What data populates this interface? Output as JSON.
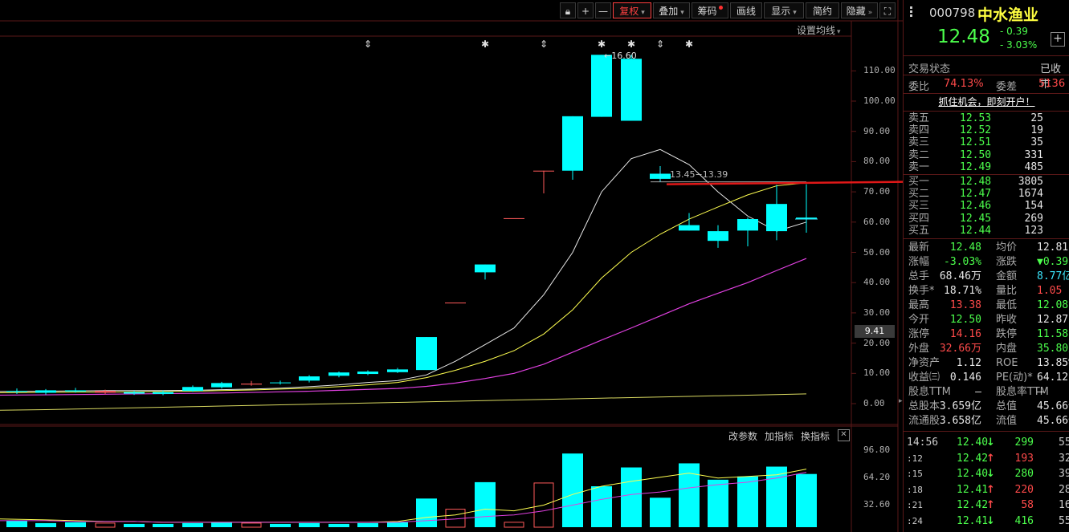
{
  "toolbar": {
    "items": [
      "复权",
      "叠加",
      "筹码",
      "画线",
      "显示",
      "简约",
      "隐藏"
    ],
    "plus": "+",
    "minus": "—",
    "setting_ma": "设置均线"
  },
  "chart": {
    "high_label": "16.60",
    "range_label": "13.45−13.39",
    "price_axis": [
      "110.00",
      "100.00",
      "90.00",
      "80.00",
      "70.00",
      "60.00",
      "50.00",
      "40.00",
      "30.00",
      "20.00",
      "10.00",
      "0.00"
    ],
    "current_marker": "9.41",
    "vol_axis": [
      "96.80",
      "64.20",
      "32.60"
    ],
    "vol_buttons": [
      "改参数",
      "加指标",
      "换指标"
    ]
  },
  "header": {
    "code": "000798",
    "name": "中水渔业",
    "price": "12.48",
    "change": "- 0.39",
    "change_pct": "- 3.03%",
    "plus": "+"
  },
  "status": {
    "label": "交易状态",
    "value": "已收市",
    "weibi_label": "委比",
    "weibi_value": "74.13%",
    "weicha_label": "委差",
    "weicha_value": "5136",
    "banner": "抓住机会，即刻开户！"
  },
  "sell": [
    {
      "label": "卖五",
      "price": "12.53",
      "vol": "25"
    },
    {
      "label": "卖四",
      "price": "12.52",
      "vol": "19"
    },
    {
      "label": "卖三",
      "price": "12.51",
      "vol": "35"
    },
    {
      "label": "卖二",
      "price": "12.50",
      "vol": "331"
    },
    {
      "label": "卖一",
      "price": "12.49",
      "vol": "485"
    }
  ],
  "buy": [
    {
      "label": "买一",
      "price": "12.48",
      "vol": "3805"
    },
    {
      "label": "买二",
      "price": "12.47",
      "vol": "1674"
    },
    {
      "label": "买三",
      "price": "12.46",
      "vol": "154"
    },
    {
      "label": "买四",
      "price": "12.45",
      "vol": "269"
    },
    {
      "label": "买五",
      "price": "12.44",
      "vol": "123"
    }
  ],
  "stats": [
    {
      "l1": "最新",
      "v1": "12.48",
      "c1": "green",
      "l2": "均价",
      "v2": "12.81",
      "c2": "white"
    },
    {
      "l1": "涨幅",
      "v1": "-3.03%",
      "c1": "green",
      "l2": "涨跌",
      "v2": "▼0.39",
      "c2": "green"
    },
    {
      "l1": "总手",
      "v1": "68.46万",
      "c1": "white",
      "l2": "金额",
      "v2": "8.77亿",
      "c2": "cyan"
    },
    {
      "l1": "换手*",
      "v1": "18.71%",
      "c1": "white",
      "l2": "量比",
      "v2": "1.05",
      "c2": "red"
    },
    {
      "l1": "最高",
      "v1": "13.38",
      "c1": "red",
      "l2": "最低",
      "v2": "12.08",
      "c2": "green"
    },
    {
      "l1": "今开",
      "v1": "12.50",
      "c1": "green",
      "l2": "昨收",
      "v2": "12.87",
      "c2": "white"
    },
    {
      "l1": "涨停",
      "v1": "14.16",
      "c1": "red",
      "l2": "跌停",
      "v2": "11.58",
      "c2": "green"
    },
    {
      "l1": "外盘",
      "v1": "32.66万",
      "c1": "red",
      "l2": "内盘",
      "v2": "35.80万",
      "c2": "green"
    },
    {
      "l1": "净资产",
      "v1": "1.12",
      "c1": "white",
      "l2": "ROE",
      "v2": "13.85%",
      "c2": "white"
    },
    {
      "l1": "收益㈢",
      "v1": "0.146",
      "c1": "white",
      "l2": "PE(动)*",
      "v2": "64.12",
      "c2": "white"
    },
    {
      "l1": "股息TTM",
      "v1": "—",
      "c1": "white",
      "l2": "股息率TTM",
      "v2": "—",
      "c2": "white"
    },
    {
      "l1": "总股本",
      "v1": "3.659亿",
      "c1": "white",
      "l2": "总值",
      "v2": "45.66亿",
      "c2": "white"
    },
    {
      "l1": "流通股",
      "v1": "3.658亿",
      "c1": "white",
      "l2": "流值",
      "v2": "45.66亿",
      "c2": "white"
    }
  ],
  "ticks": [
    {
      "time": "14:56",
      "price": "12.40",
      "dir": "down",
      "vol": "299",
      "num": "55"
    },
    {
      "time": ":12",
      "price": "12.42",
      "dir": "up",
      "vol": "193",
      "num": "32"
    },
    {
      "time": ":15",
      "price": "12.40",
      "dir": "down",
      "vol": "280",
      "num": "39"
    },
    {
      "time": ":18",
      "price": "12.41",
      "dir": "up",
      "vol": "220",
      "num": "28"
    },
    {
      "time": ":21",
      "price": "12.42",
      "dir": "up",
      "vol": "58",
      "num": "16"
    },
    {
      "time": ":24",
      "price": "12.41",
      "dir": "down",
      "vol": "416",
      "num": "55"
    }
  ],
  "colors": {
    "up": "#ff5a5a",
    "down": "#00ffff",
    "ma5": "#e8e8e8",
    "ma10": "#ffff50",
    "ma20": "#e040e0",
    "ma60": "#d8d860"
  }
}
